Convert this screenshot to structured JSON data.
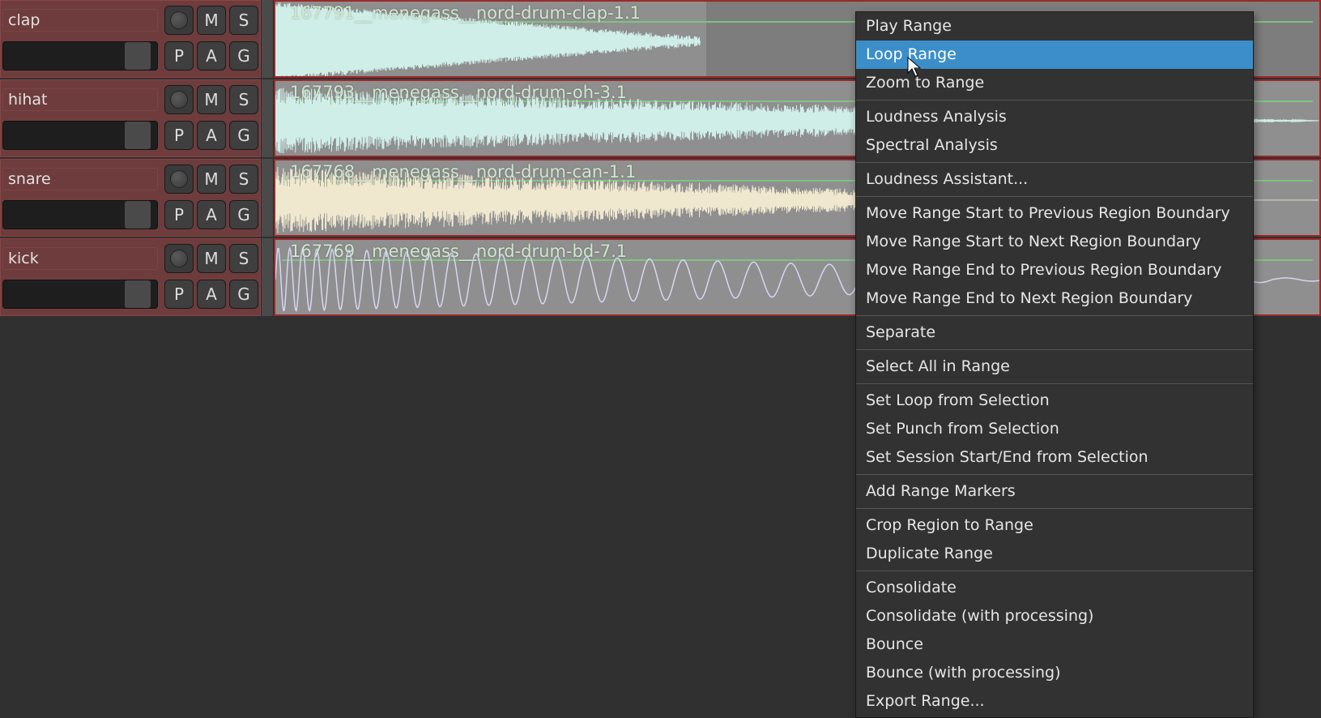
{
  "tracks": [
    {
      "name": "clap",
      "region_label": "167791__menegass__nord-drum-clap-1.1",
      "wave": "clap",
      "wave_color": "#cfeee8"
    },
    {
      "name": "hihat",
      "region_label": "167793__menegass__nord-drum-oh-3.1",
      "wave": "hihat",
      "wave_color": "#cfeee8"
    },
    {
      "name": "snare",
      "region_label": "167768__menegass__nord-drum-can-1.1",
      "wave": "snare",
      "wave_color": "#efe8cf"
    },
    {
      "name": "kick",
      "region_label": "167769__menegass__nord-drum-bd-7.1",
      "wave": "kick",
      "wave_color": "#d6d6f4"
    }
  ],
  "buttons": {
    "M": "M",
    "S": "S",
    "P": "P",
    "A": "A",
    "G": "G"
  },
  "menu": {
    "highlight_index": 1,
    "items": [
      "Play Range",
      "Loop Range",
      "Zoom to Range",
      "---",
      "Loudness Analysis",
      "Spectral Analysis",
      "---",
      "Loudness Assistant...",
      "---",
      "Move Range Start to Previous Region Boundary",
      "Move Range Start to Next Region Boundary",
      "Move Range End to Previous Region Boundary",
      "Move Range End to Next Region Boundary",
      "---",
      "Separate",
      "---",
      "Select All in Range",
      "---",
      "Set Loop from Selection",
      "Set Punch from Selection",
      "Set Session Start/End from Selection",
      "---",
      "Add Range Markers",
      "---",
      "Crop Region to Range",
      "Duplicate Range",
      "---",
      "Consolidate",
      "Consolidate (with processing)",
      "Bounce",
      "Bounce (with processing)",
      "Export Range..."
    ]
  }
}
